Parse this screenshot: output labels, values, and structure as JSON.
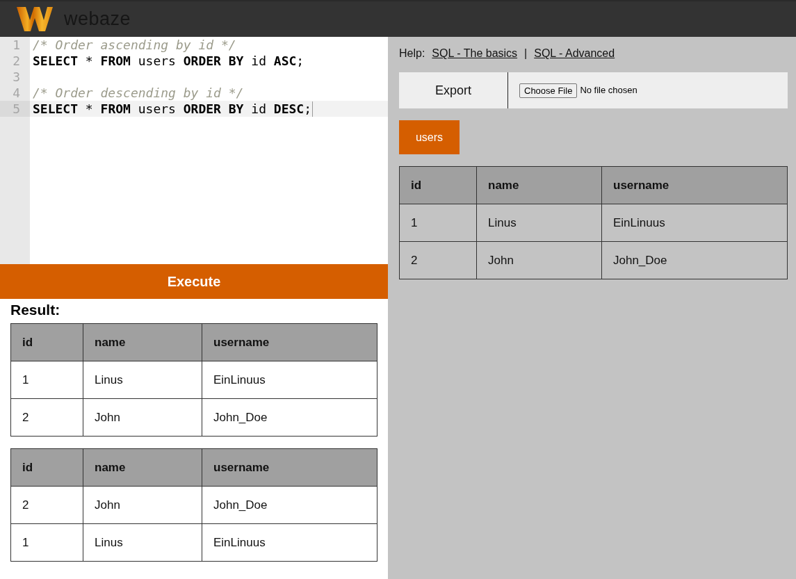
{
  "header": {
    "logo_text": "webaze"
  },
  "editor": {
    "lines": [
      {
        "number": "1",
        "active": false,
        "tokens": [
          {
            "kind": "comment",
            "text": "/* Order ascending by id */"
          }
        ]
      },
      {
        "number": "2",
        "active": false,
        "tokens": [
          {
            "kind": "keyword",
            "text": "SELECT"
          },
          {
            "kind": "plain",
            "text": " * "
          },
          {
            "kind": "keyword",
            "text": "FROM"
          },
          {
            "kind": "plain",
            "text": " users "
          },
          {
            "kind": "keyword",
            "text": "ORDER BY"
          },
          {
            "kind": "plain",
            "text": " id "
          },
          {
            "kind": "keyword",
            "text": "ASC"
          },
          {
            "kind": "plain",
            "text": ";"
          }
        ]
      },
      {
        "number": "3",
        "active": false
      },
      {
        "number": "4",
        "active": false,
        "tokens": [
          {
            "kind": "comment",
            "text": "/* Order descending by id */"
          }
        ]
      },
      {
        "number": "5",
        "active": true,
        "tokens": [
          {
            "kind": "keyword",
            "text": "SELECT"
          },
          {
            "kind": "plain",
            "text": " * "
          },
          {
            "kind": "keyword",
            "text": "FROM"
          },
          {
            "kind": "plain",
            "text": " users "
          },
          {
            "kind": "keyword",
            "text": "ORDER BY"
          },
          {
            "kind": "plain",
            "text": " id "
          },
          {
            "kind": "keyword",
            "text": "DESC"
          },
          {
            "kind": "plain",
            "text": ";"
          }
        ]
      }
    ]
  },
  "execute_button": {
    "label": "Execute"
  },
  "result": {
    "title": "Result:",
    "tables": [
      {
        "columns": [
          "id",
          "name",
          "username"
        ],
        "rows": [
          [
            "1",
            "Linus",
            "EinLinuus"
          ],
          [
            "2",
            "John",
            "John_Doe"
          ]
        ]
      },
      {
        "columns": [
          "id",
          "name",
          "username"
        ],
        "rows": [
          [
            "2",
            "John",
            "John_Doe"
          ],
          [
            "1",
            "Linus",
            "EinLinuus"
          ]
        ]
      }
    ]
  },
  "help": {
    "label": "Help:",
    "links": [
      "SQL - The basics",
      "SQL - Advanced"
    ],
    "separator": "|"
  },
  "export": {
    "label": "Export",
    "file_button": "Choose File",
    "file_status": "No file chosen"
  },
  "table_tabs": [
    {
      "label": "users",
      "selected": true
    }
  ],
  "table_preview": {
    "columns": [
      "id",
      "name",
      "username"
    ],
    "rows": [
      [
        "1",
        "Linus",
        "EinLinuus"
      ],
      [
        "2",
        "John",
        "John_Doe"
      ]
    ]
  }
}
